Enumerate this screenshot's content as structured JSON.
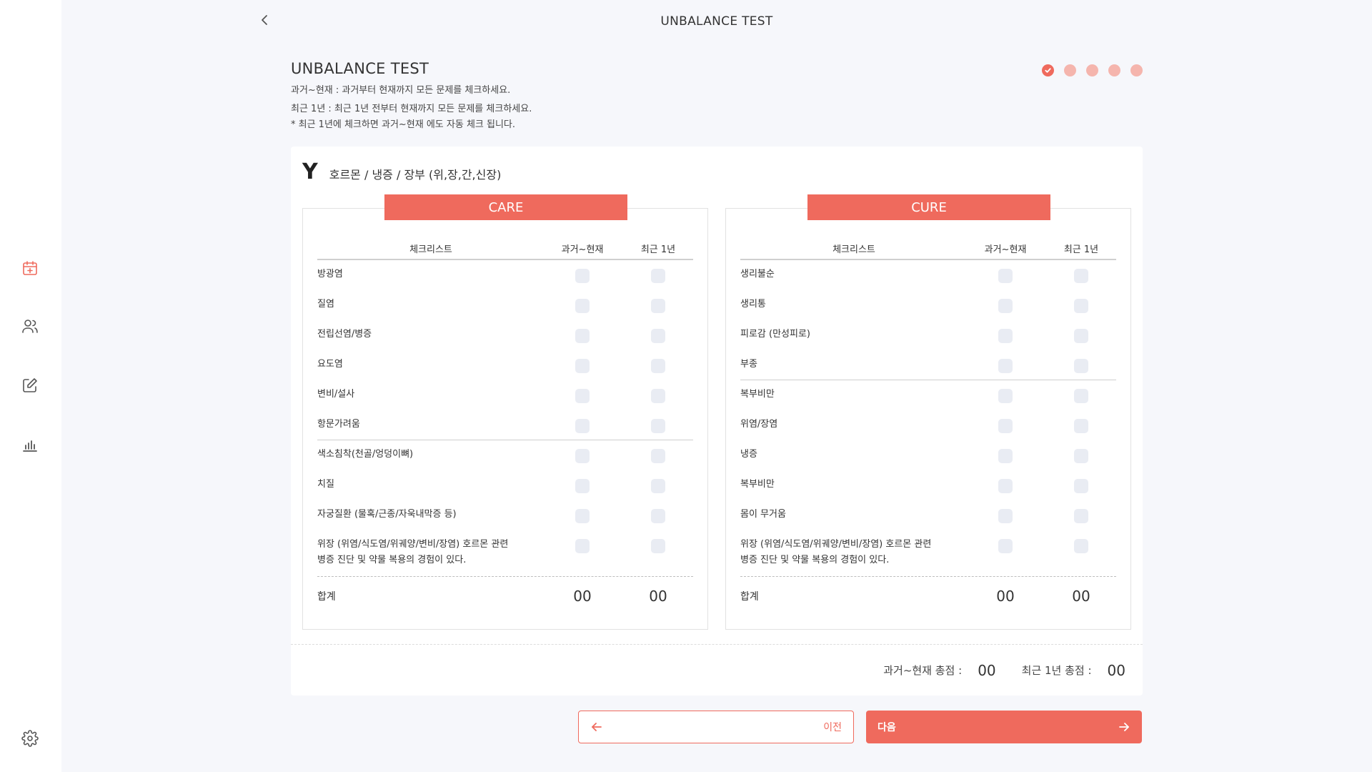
{
  "header": {
    "title": "UNBALANCE TEST"
  },
  "page": {
    "title": "UNBALANCE TEST",
    "desc_line1": "과거~현재 : 과거부터 현재까지 모든 문제를 체크하세요.",
    "desc_line2": "최근 1년 : 최근 1년 전부터 현재까지 모든 문제를 체크하세요.",
    "desc_line3": "* 최근 1년에 체크하면 과거~현재 에도 자동 체크 됩니다."
  },
  "steps": {
    "current": 1,
    "total": 5
  },
  "section": {
    "letter": "Y",
    "title": "호르몬 / 냉증 / 장부 (위,장,간,신장)"
  },
  "table_headers": {
    "name": "체크리스트",
    "past": "과거~현재",
    "recent": "최근 1년"
  },
  "care": {
    "label": "CARE",
    "items": [
      "방광염",
      "질염",
      "전립선염/병증",
      "요도염",
      "변비/설사",
      "항문가려움",
      "색소침착(천골/엉덩이뼈)",
      "치질",
      "자궁질환 (물혹/근종/자욱내막증 등)",
      "위장 (위염/식도염/위궤양/변비/장염) 호르몬 관련",
      "병증 진단 및 약물 복용의 경험이 있다."
    ],
    "sum_label": "합계",
    "sum_past": "00",
    "sum_recent": "00"
  },
  "cure": {
    "label": "CURE",
    "items": [
      "생리불순",
      "생리통",
      "피로감 (만성피로)",
      "부종",
      "복부비만",
      "위염/장염",
      "냉증",
      "복부비만",
      "몸이 무거움",
      "위장 (위염/식도염/위궤양/변비/장염) 호르몬 관련",
      "병증 진단 및 약물 복용의 경험이 있다."
    ],
    "sum_label": "합계",
    "sum_past": "00",
    "sum_recent": "00"
  },
  "totals": {
    "past_label": "과거~현재 총점 :",
    "past_value": "00",
    "recent_label": "최근 1년 총점 :",
    "recent_value": "00"
  },
  "buttons": {
    "prev_label": "이전",
    "next_label": "다음"
  },
  "colors": {
    "accent": "#ef6a5d",
    "accent_light": "#f5b5ad",
    "checkbox": "#e9ecf3"
  },
  "icons": {
    "back": "chevron-left-icon",
    "calendar": "calendar-plus-icon",
    "users": "users-icon",
    "edit": "edit-icon",
    "chart": "bar-chart-icon",
    "settings": "gear-icon"
  }
}
